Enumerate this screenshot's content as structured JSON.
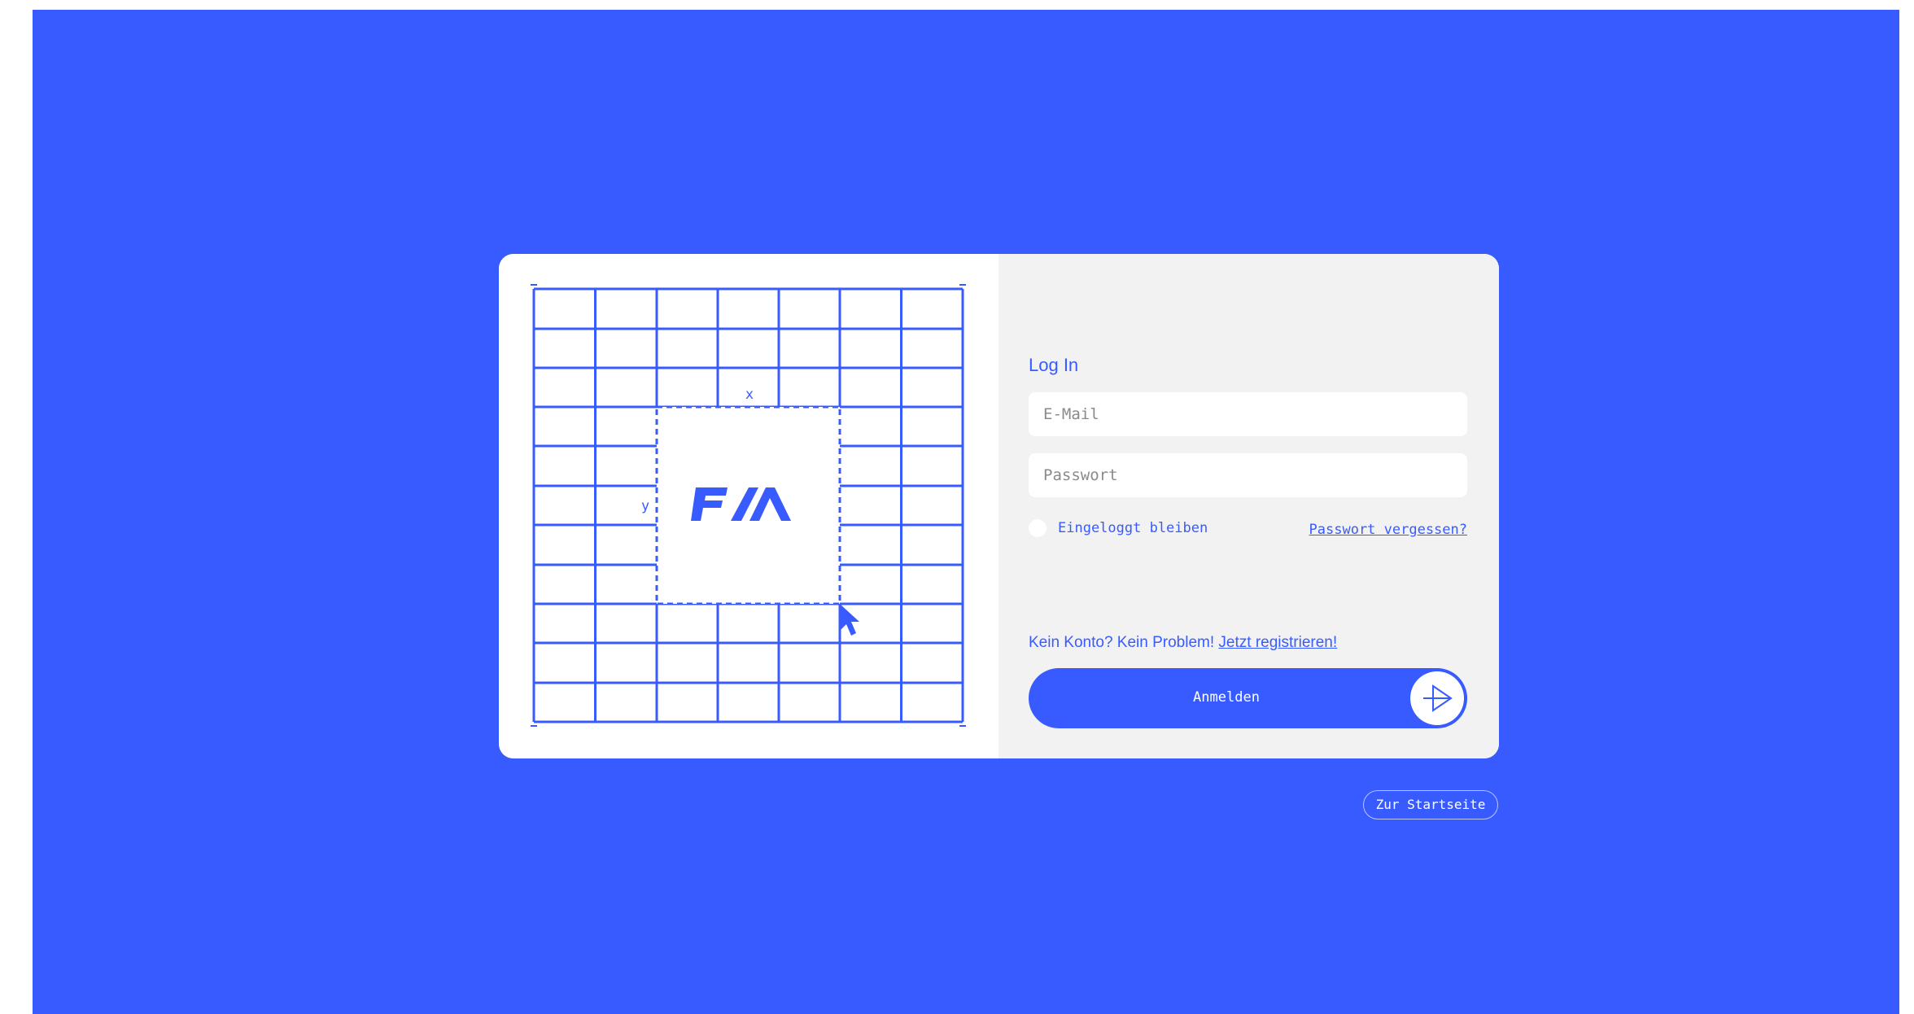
{
  "illustration": {
    "axis_x_label": "x",
    "axis_y_label": "y",
    "logo_text": "F/A"
  },
  "login": {
    "title": "Log In",
    "email_placeholder": "E-Mail",
    "password_placeholder": "Passwort",
    "remember_label": "Eingeloggt bleiben",
    "forgot_label": "Passwort vergessen?",
    "register_prompt": "Kein Konto? Kein Problem!",
    "register_link": "Jetzt registrieren!",
    "submit_label": "Anmelden"
  },
  "footer": {
    "home_label": "Zur Startseite"
  },
  "colors": {
    "accent": "#385bff",
    "panel": "#f2f2f2",
    "card": "#ffffff"
  },
  "icons": {
    "submit": "arrow-right-icon",
    "cursor": "mouse-pointer-icon",
    "logo": "fa-logo"
  }
}
